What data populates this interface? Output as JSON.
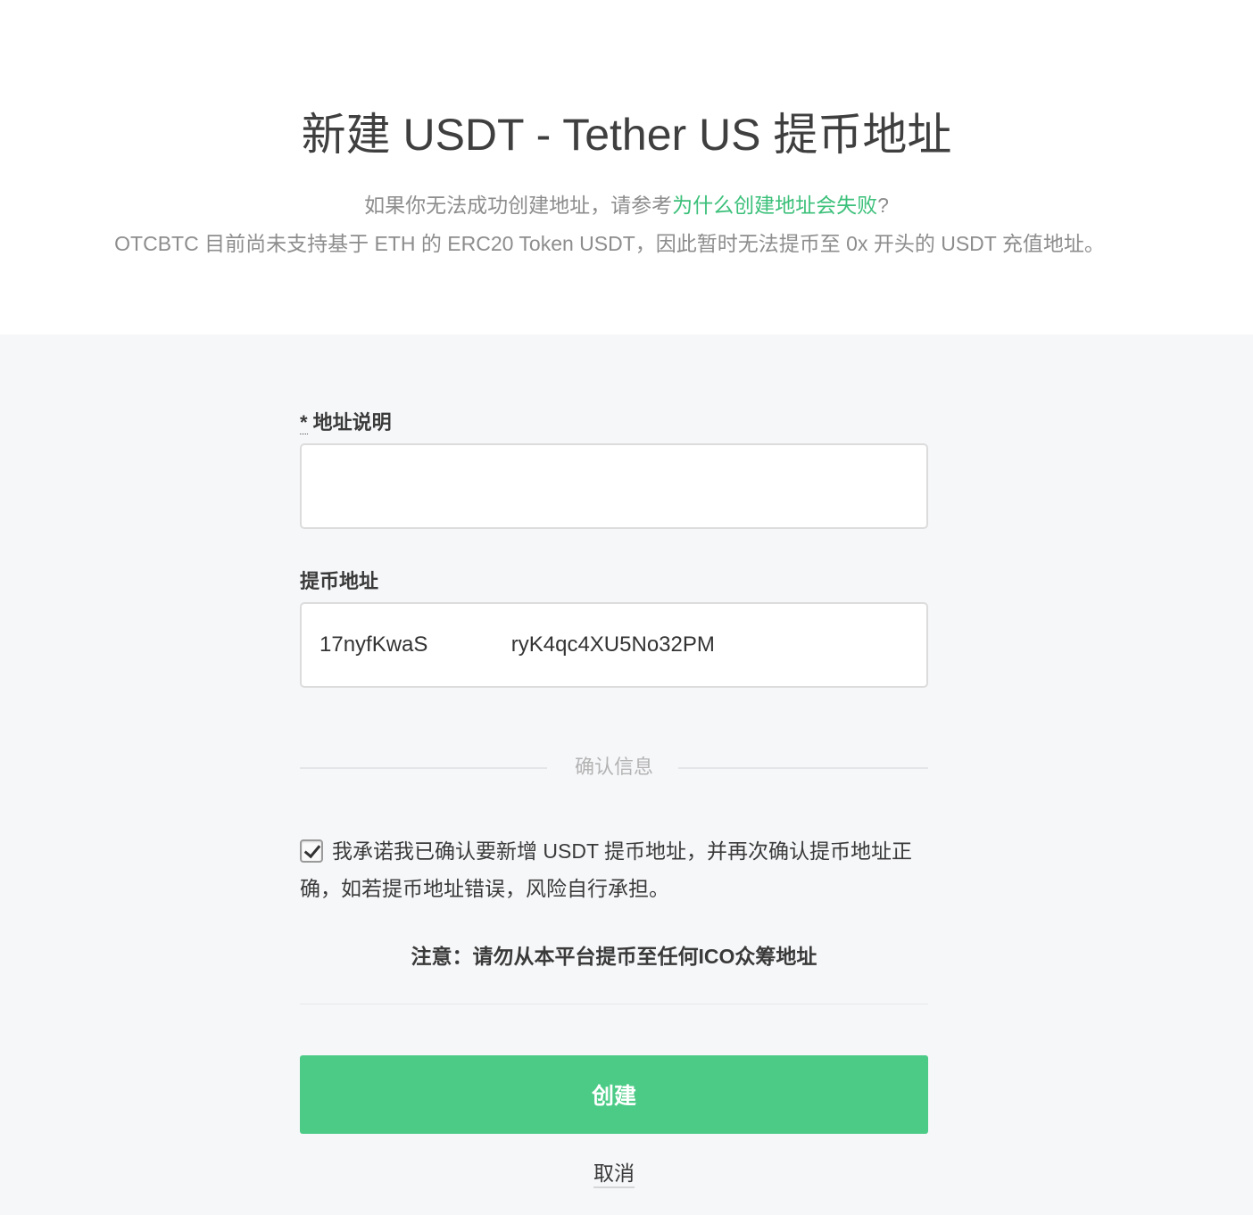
{
  "header": {
    "title": "新建 USDT - Tether US 提币地址",
    "hint_prefix": "如果你无法成功创建地址，请参考",
    "hint_link": "为什么创建地址会失败",
    "hint_suffix": "?",
    "notice": "OTCBTC 目前尚未支持基于 ETH 的 ERC20 Token USDT，因此暂时无法提币至 0x 开头的 USDT 充值地址。"
  },
  "form": {
    "label_field": {
      "required_mark": "*",
      "label": "地址说明",
      "value": ""
    },
    "address_field": {
      "label": "提币地址",
      "value": "17nyfKwaS              ryK4qc4XU5No32PM"
    },
    "divider_text": "确认信息",
    "confirm": {
      "checked": true,
      "text": "我承诺我已确认要新增 USDT 提币地址，并再次确认提币地址正确，如若提币地址错误，风险自行承担。"
    },
    "warning": "注意：请勿从本平台提币至任何ICO众筹地址",
    "create_label": "创建",
    "cancel_label": "取消"
  },
  "colors": {
    "accent": "#4ccb87",
    "link": "#3cc07a",
    "background": "#f6f7f9"
  }
}
